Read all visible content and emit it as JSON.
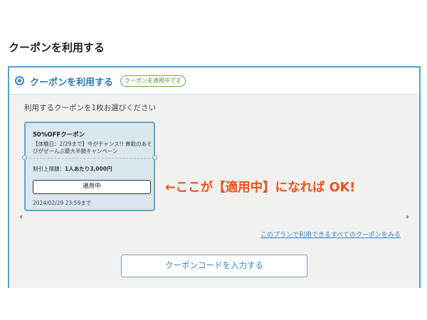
{
  "page": {
    "title": "クーポンを利用する"
  },
  "panel": {
    "header_label": "クーポンを利用する",
    "applied_badge": "クーポンを適用中です",
    "instruction": "利用するクーポンを1枚お選びください"
  },
  "coupon": {
    "name": "50%OFFクーポン",
    "description": "【体験日：2/29まで】今がチャンス!! 貴歌のあそびがぜーんぶ最大半額キャンペーン",
    "discount_label": "割引上限額：",
    "discount_value": "1人あたり3,000円",
    "status_button": "適用中",
    "expiry": "2024/02/29 23:59まで"
  },
  "annotation": {
    "text": "←ここが【適用中】になれば OK!",
    "color": "#e8541c"
  },
  "links": {
    "all_coupons": "このプランで利用できるすべてのクーポンをみる"
  },
  "buttons": {
    "enter_code": "クーポンコードを入力する"
  },
  "colors": {
    "accent": "#3a86c8",
    "badge": "#4f9a2a",
    "panel_bg": "#f1f1ef",
    "card_bg": "#dbe7ee"
  },
  "icons": {
    "radio": "radio-selected-icon",
    "scroll_left": "scroll-left-arrow-icon",
    "scroll_right": "scroll-right-arrow-icon"
  }
}
